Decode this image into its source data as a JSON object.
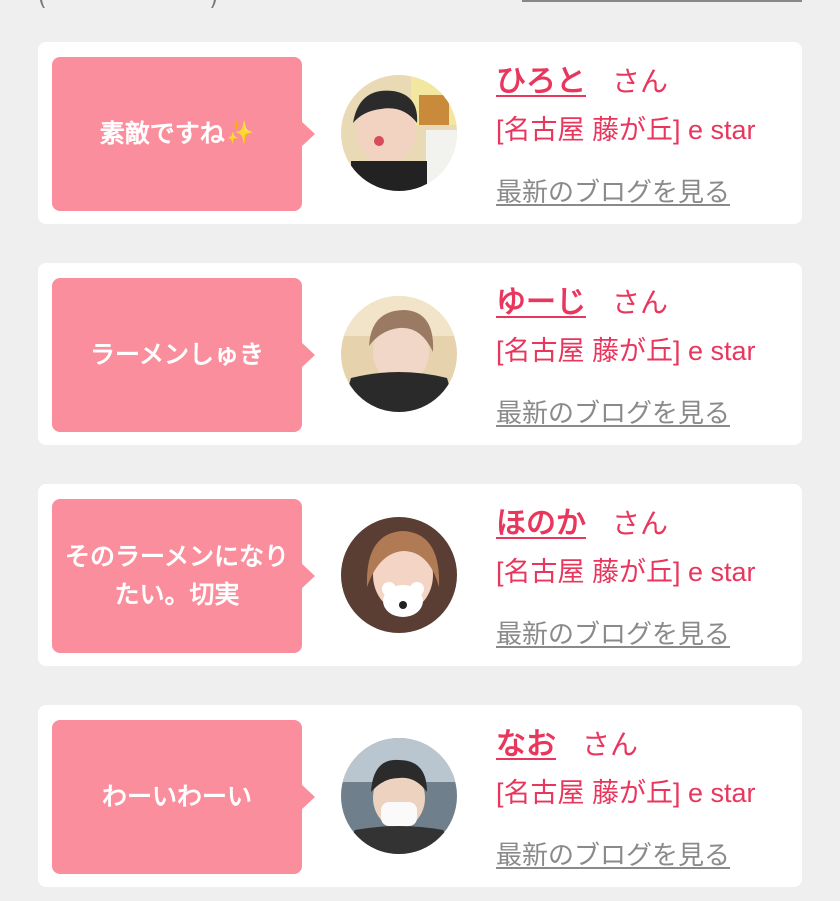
{
  "colors": {
    "background": "#efefef",
    "card": "#ffffff",
    "bubble": "#fb8e9c",
    "accent": "#e8365d",
    "link_gray": "#8a8a8a"
  },
  "cards": [
    {
      "comment": "素敵ですね",
      "comment_icon": "sparkle-icon",
      "name": "ひろと",
      "honorific": "さん",
      "shop": "[名古屋 藤が丘] e star",
      "blog_link": "最新のブログを見る"
    },
    {
      "comment": "ラーメンしゅき",
      "name": "ゆーじ",
      "honorific": "さん",
      "shop": "[名古屋 藤が丘] e star",
      "blog_link": "最新のブログを見る"
    },
    {
      "comment": "そのラーメンになりたい。切実",
      "name": "ほのか",
      "honorific": "さん",
      "shop": "[名古屋 藤が丘] e star",
      "blog_link": "最新のブログを見る"
    },
    {
      "comment": "わーいわーい",
      "name": "なお",
      "honorific": "さん",
      "shop": "[名古屋 藤が丘] e star",
      "blog_link": "最新のブログを見る"
    }
  ]
}
